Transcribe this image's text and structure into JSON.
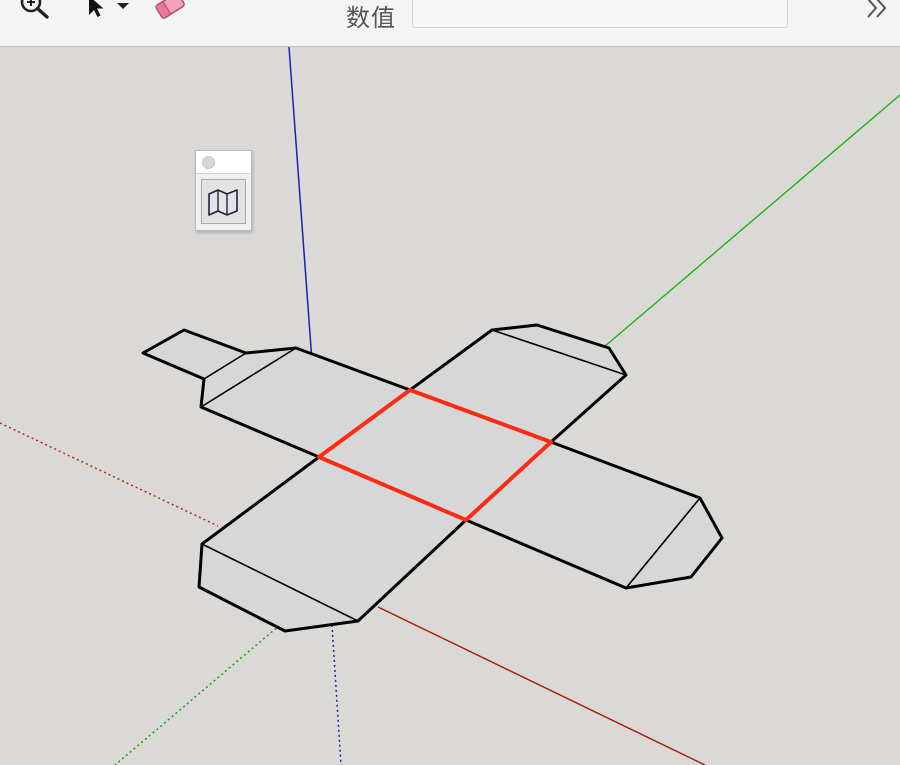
{
  "toolbar": {
    "tools": [
      {
        "name": "zoom-tool",
        "icon": "magnifier-icon"
      },
      {
        "name": "select-tool",
        "icon": "arrow-cursor-icon",
        "has_dropdown": true
      },
      {
        "name": "eraser-tool",
        "icon": "eraser-icon"
      }
    ],
    "measurements_label": "数值",
    "measurements_value": "",
    "overflow_icon": "double-chevron-right-icon"
  },
  "floating_palette": {
    "tool_icon": "unfold-map-icon"
  },
  "scene": {
    "axis_colors": {
      "red": "#a02010",
      "green": "#12b012",
      "blue": "#1a1ab0"
    },
    "edge_color": "#000000",
    "face_color": "#d6d6d6",
    "selected_edge_color": "#ff2a10",
    "background": "#dad9d6"
  }
}
